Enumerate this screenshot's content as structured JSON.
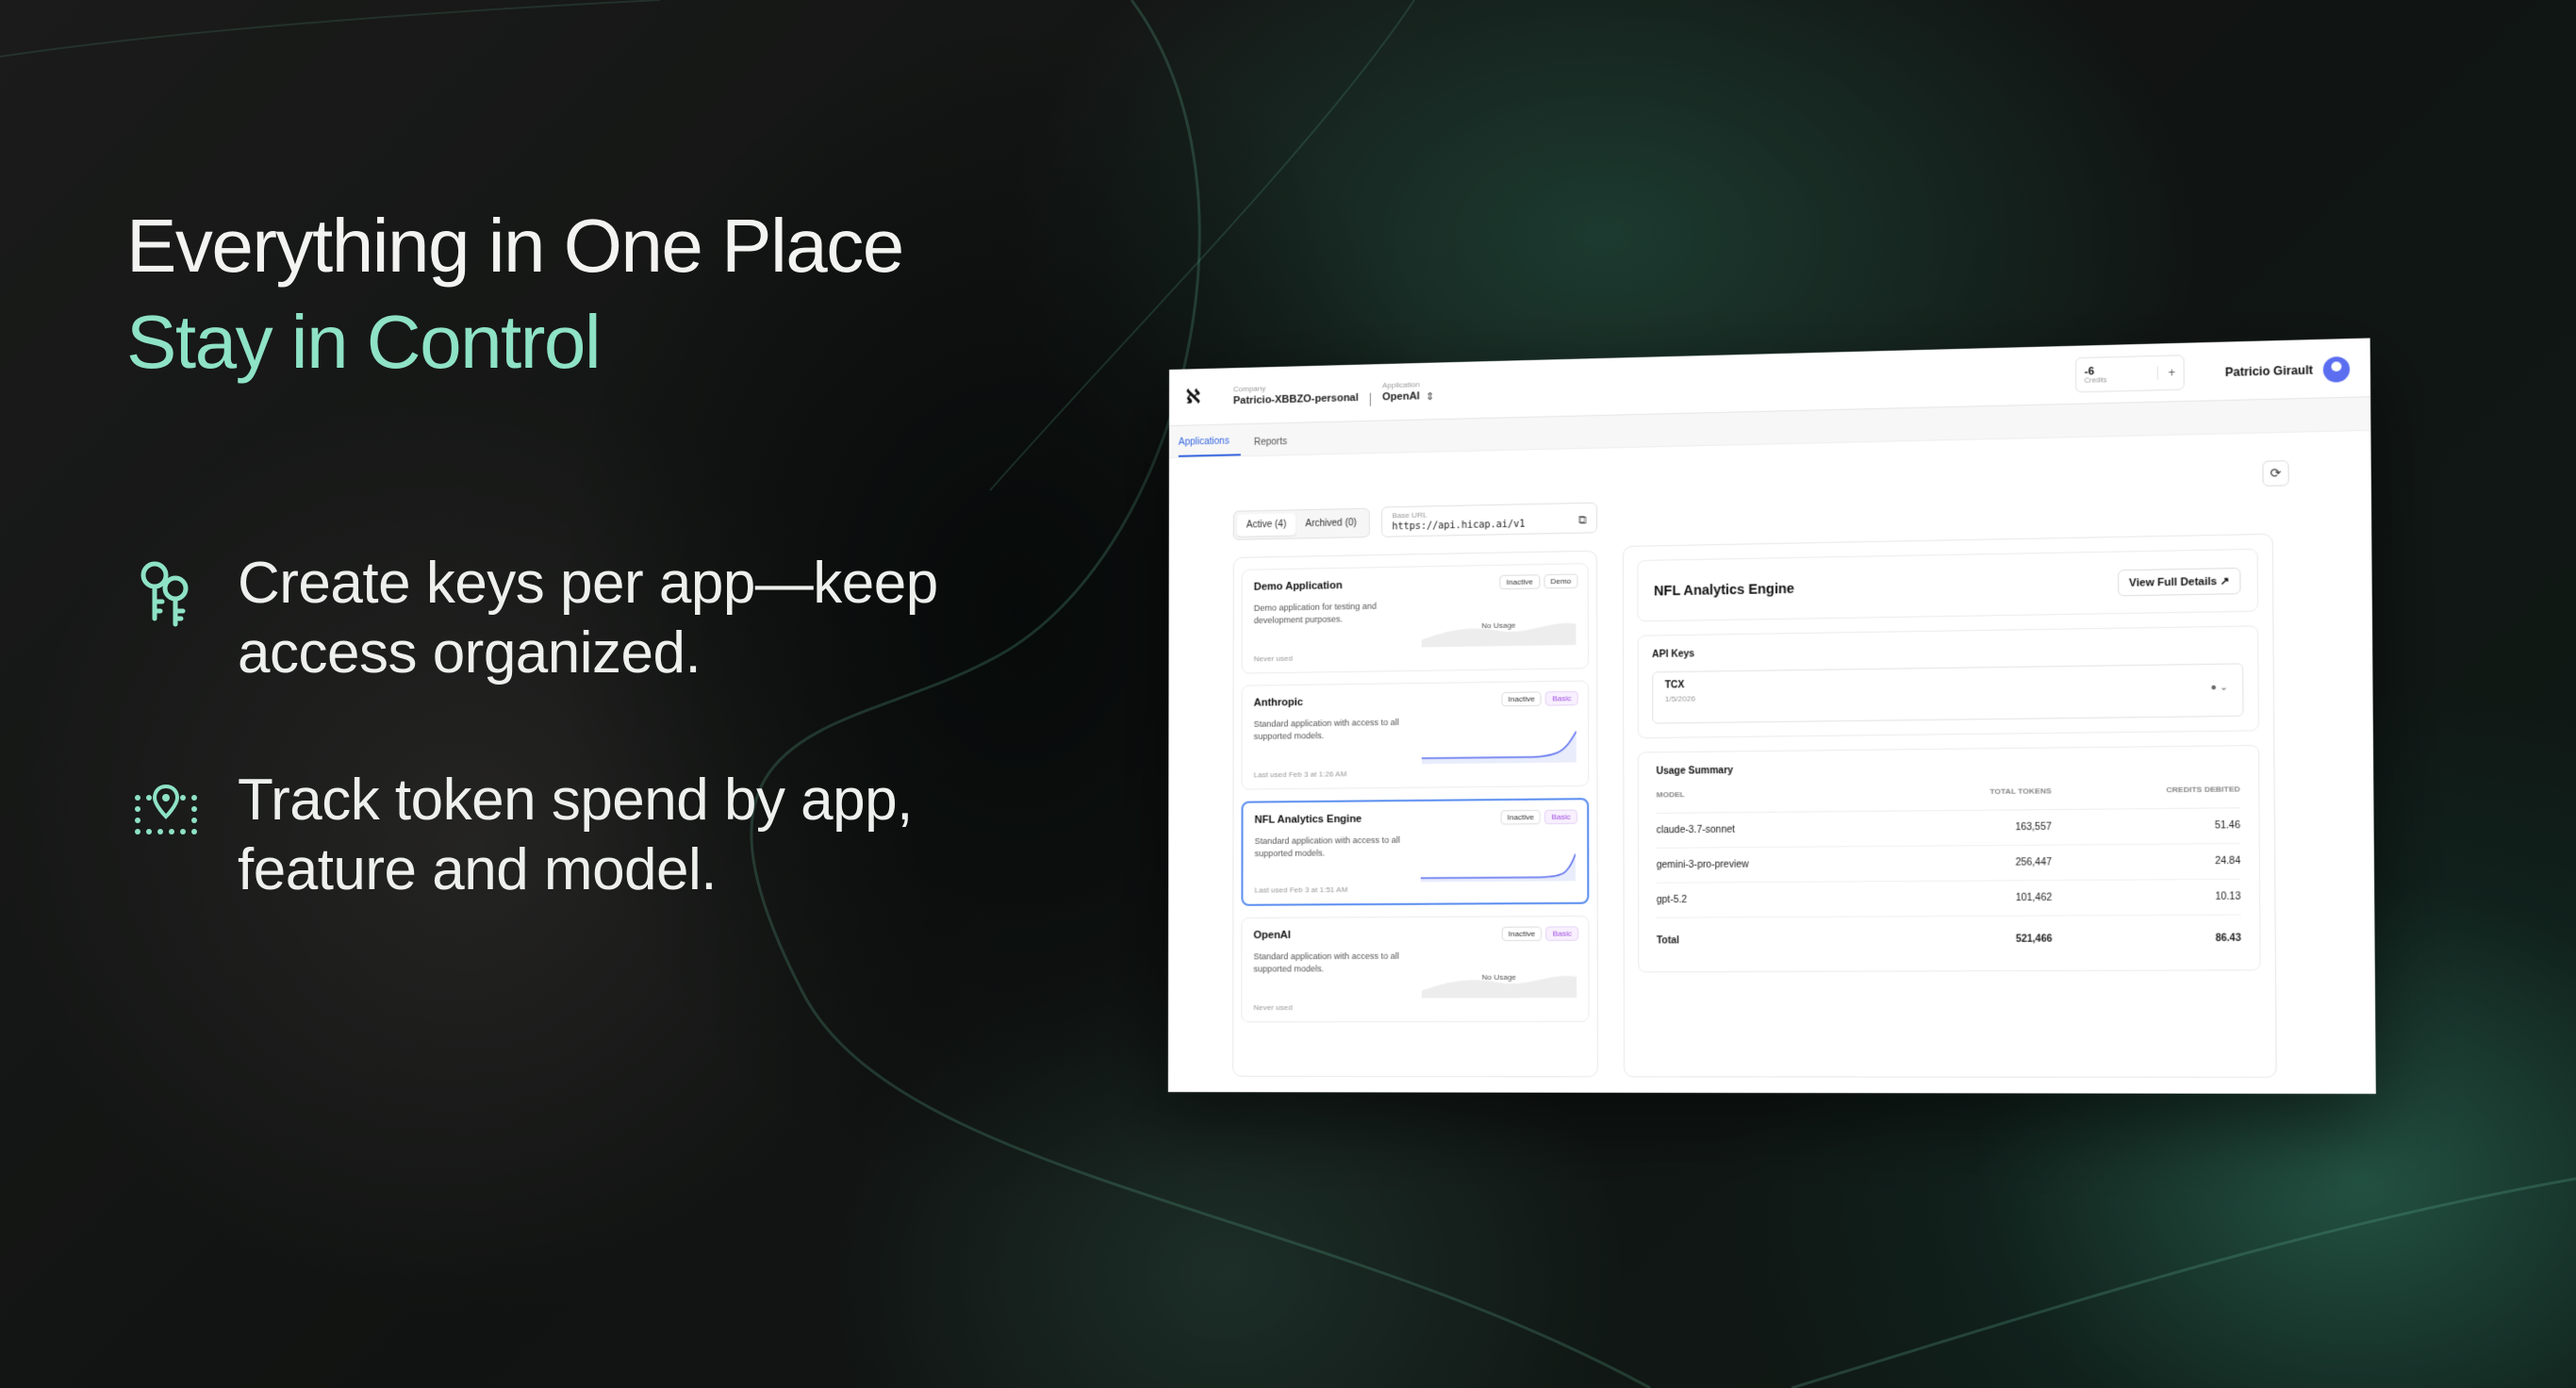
{
  "hero": {
    "title": "Everything in One Place",
    "subtitle": "Stay in Control"
  },
  "features": [
    {
      "icon": "keys-icon",
      "text": "Create keys per app—keep access organized."
    },
    {
      "icon": "location-tracking-icon",
      "text": "Track token spend by app, feature and model."
    }
  ],
  "colors": {
    "accent": "#8ee2c6",
    "link": "#3566e0",
    "selected_border": "#5b8ef0",
    "basic_badge": "#a04de0"
  },
  "app_ui": {
    "logo": "ℵ",
    "company_label": "Company",
    "company_value": "Patricio-XBBZO-personal",
    "application_label": "Application",
    "application_value": "OpenAI",
    "credits_value": "-6",
    "credits_label": "Credits",
    "credits_plus": "+",
    "user_name": "Patricio Girault",
    "nav_tabs": [
      "Applications",
      "Reports"
    ],
    "status_tabs": [
      "Active (4)",
      "Archived (0)"
    ],
    "base_url_label": "Base URL",
    "base_url_value": "https://api.hicap.ai/v1",
    "apps": [
      {
        "name": "Demo Application",
        "status": "Inactive",
        "tier": "Demo",
        "description": "Demo application for testing and development purposes.",
        "usage": "No Usage",
        "last_used": "Never used"
      },
      {
        "name": "Anthropic",
        "status": "Inactive",
        "tier": "Basic",
        "description": "Standard application with access to all supported models.",
        "usage": "",
        "last_used": "Last used Feb 3 at 1:26 AM"
      },
      {
        "name": "NFL Analytics Engine",
        "status": "Inactive",
        "tier": "Basic",
        "description": "Standard application with access to all supported models.",
        "usage": "",
        "last_used": "Last used Feb 3 at 1:51 AM"
      },
      {
        "name": "OpenAI",
        "status": "Inactive",
        "tier": "Basic",
        "description": "Standard application with access to all supported models.",
        "usage": "No Usage",
        "last_used": "Never used"
      }
    ],
    "detail": {
      "title": "NFL Analytics Engine",
      "view_button": "View Full Details",
      "api_keys_heading": "API Keys",
      "key_name": "TCX",
      "key_date": "1/5/2026",
      "usage_heading": "Usage Summary",
      "columns": [
        "MODEL",
        "TOTAL TOKENS",
        "CREDITS DEBITED"
      ],
      "rows": [
        [
          "claude-3.7-sonnet",
          "163,557",
          "51.46"
        ],
        [
          "gemini-3-pro-preview",
          "256,447",
          "24.84"
        ],
        [
          "gpt-5.2",
          "101,462",
          "10.13"
        ]
      ],
      "total": [
        "Total",
        "521,466",
        "86.43"
      ]
    }
  }
}
